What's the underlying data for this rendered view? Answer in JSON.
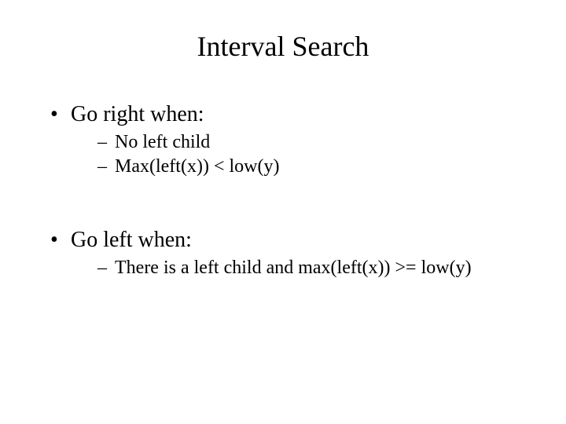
{
  "title": "Interval Search",
  "bullets": [
    {
      "text": "Go right when:",
      "subs": [
        "No left child",
        "Max(left(x)) < low(y)"
      ]
    },
    {
      "text": "Go left when:",
      "subs": [
        "There is a left child and max(left(x)) >= low(y)"
      ]
    }
  ]
}
